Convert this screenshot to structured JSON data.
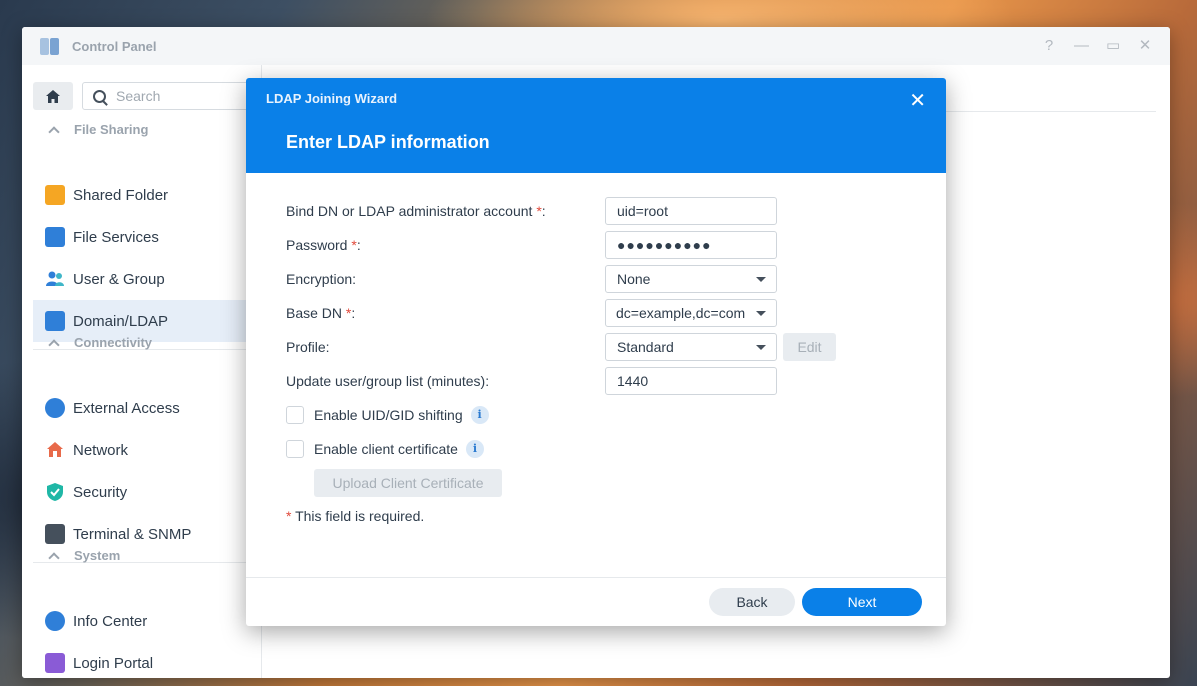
{
  "window": {
    "title": "Control Panel",
    "controls": [
      "?",
      "—",
      "▭",
      "✕"
    ]
  },
  "sidebar": {
    "search_placeholder": "Search",
    "sections": [
      {
        "label": "File Sharing"
      },
      {
        "label": "Connectivity"
      },
      {
        "label": "System"
      }
    ],
    "items": [
      {
        "label": "Shared Folder",
        "icon": "shared-folder-icon"
      },
      {
        "label": "File Services",
        "icon": "file-services-icon"
      },
      {
        "label": "User & Group",
        "icon": "user-group-icon"
      },
      {
        "label": "Domain/LDAP",
        "icon": "domain-ldap-icon",
        "active": true
      },
      {
        "label": "External Access",
        "icon": "external-access-icon"
      },
      {
        "label": "Network",
        "icon": "network-icon"
      },
      {
        "label": "Security",
        "icon": "security-shield-icon"
      },
      {
        "label": "Terminal & SNMP",
        "icon": "terminal-icon"
      },
      {
        "label": "Info Center",
        "icon": "info-center-icon"
      },
      {
        "label": "Login Portal",
        "icon": "login-portal-icon"
      }
    ]
  },
  "dialog": {
    "title": "LDAP Joining Wizard",
    "close": "✕",
    "heading": "Enter LDAP information",
    "fields": {
      "bind_dn": {
        "label": "Bind DN or LDAP administrator account",
        "req": "*",
        "colon": ":",
        "value": "uid=root"
      },
      "password": {
        "label": "Password",
        "req": "*",
        "colon": ":",
        "value": "●●●●●●●●●●"
      },
      "encryption": {
        "label": "Encryption:",
        "value": "None"
      },
      "base_dn": {
        "label": "Base DN",
        "req": "*",
        "colon": ":",
        "value": "dc=example,dc=com"
      },
      "profile": {
        "label": "Profile:",
        "value": "Standard",
        "edit_label": "Edit"
      },
      "update_list": {
        "label": "Update user/group list (minutes):",
        "value": "1440"
      }
    },
    "checkboxes": {
      "uid_gid": {
        "label": "Enable UID/GID shifting",
        "checked": false
      },
      "client_cert": {
        "label": "Enable client certificate",
        "checked": false
      }
    },
    "info_glyph": "i",
    "upload_label": "Upload Client Certificate",
    "required_note": {
      "mark": "*",
      "text": "This field is required."
    },
    "back_label": "Back",
    "next_label": "Next"
  },
  "colors": {
    "accent": "#0a80e8",
    "required": "#e0483a",
    "active_bg": "#e6eef8"
  }
}
